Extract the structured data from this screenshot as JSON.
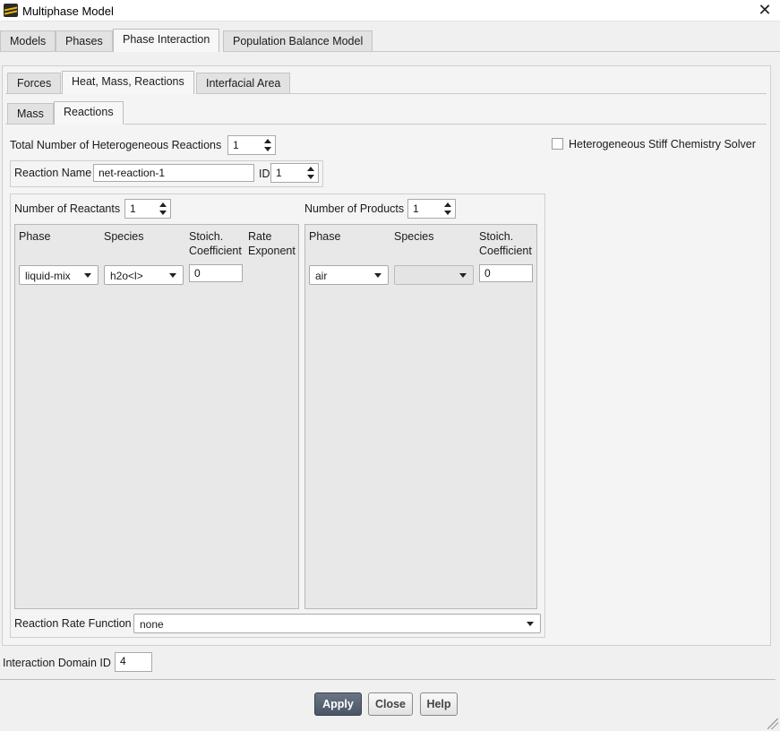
{
  "window": {
    "title": "Multiphase Model"
  },
  "main_tabs": [
    "Models",
    "Phases",
    "Phase Interaction",
    "Population Balance Model"
  ],
  "sub_tabs": [
    "Forces",
    "Heat, Mass, Reactions",
    "Interfacial Area"
  ],
  "inner_tabs": [
    "Mass",
    "Reactions"
  ],
  "reactions": {
    "total_label": "Total Number of Heterogeneous Reactions",
    "total_value": "1",
    "stiff_solver_label": "Heterogeneous Stiff Chemistry Solver",
    "name_label": "Reaction Name",
    "name_value": "net-reaction-1",
    "id_label": "ID",
    "id_value": "1"
  },
  "reactants": {
    "count_label": "Number of Reactants",
    "count_value": "1",
    "columns": {
      "phase": "Phase",
      "species": "Species",
      "stoich_1": "Stoich.",
      "stoich_2": "Coefficient",
      "rate_1": "Rate",
      "rate_2": "Exponent"
    },
    "row": {
      "phase": "liquid-mix",
      "species": "h2o<l>",
      "stoich": "0"
    }
  },
  "products": {
    "count_label": "Number of Products",
    "count_value": "1",
    "columns": {
      "phase": "Phase",
      "species": "Species",
      "stoich_1": "Stoich.",
      "stoich_2": "Coefficient"
    },
    "row": {
      "phase": "air",
      "species": "",
      "stoich": "0"
    }
  },
  "rate_function": {
    "label": "Reaction Rate Function",
    "value": "none"
  },
  "domain": {
    "label": "Interaction Domain ID",
    "value": "4"
  },
  "buttons": {
    "apply": "Apply",
    "close": "Close",
    "help": "Help"
  },
  "colors": {
    "primary_button": "#4f5a6b",
    "window_bg": "#f0f0f0"
  }
}
